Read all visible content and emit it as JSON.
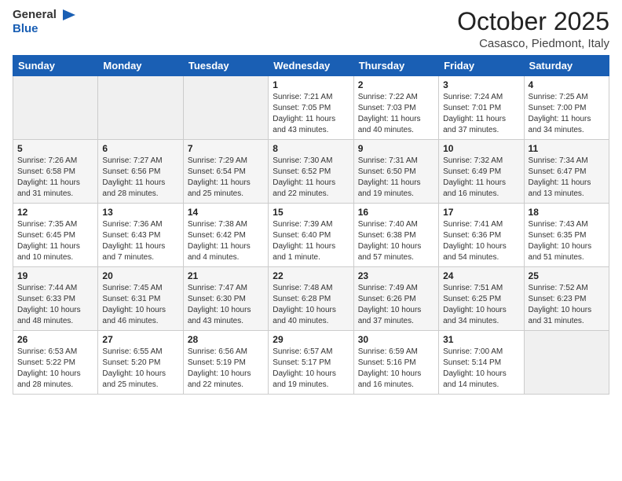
{
  "header": {
    "logo_general": "General",
    "logo_blue": "Blue",
    "month": "October 2025",
    "location": "Casasco, Piedmont, Italy"
  },
  "days_of_week": [
    "Sunday",
    "Monday",
    "Tuesday",
    "Wednesday",
    "Thursday",
    "Friday",
    "Saturday"
  ],
  "weeks": [
    [
      {
        "day": "",
        "sunrise": "",
        "sunset": "",
        "daylight": ""
      },
      {
        "day": "",
        "sunrise": "",
        "sunset": "",
        "daylight": ""
      },
      {
        "day": "",
        "sunrise": "",
        "sunset": "",
        "daylight": ""
      },
      {
        "day": "1",
        "sunrise": "Sunrise: 7:21 AM",
        "sunset": "Sunset: 7:05 PM",
        "daylight": "Daylight: 11 hours and 43 minutes."
      },
      {
        "day": "2",
        "sunrise": "Sunrise: 7:22 AM",
        "sunset": "Sunset: 7:03 PM",
        "daylight": "Daylight: 11 hours and 40 minutes."
      },
      {
        "day": "3",
        "sunrise": "Sunrise: 7:24 AM",
        "sunset": "Sunset: 7:01 PM",
        "daylight": "Daylight: 11 hours and 37 minutes."
      },
      {
        "day": "4",
        "sunrise": "Sunrise: 7:25 AM",
        "sunset": "Sunset: 7:00 PM",
        "daylight": "Daylight: 11 hours and 34 minutes."
      }
    ],
    [
      {
        "day": "5",
        "sunrise": "Sunrise: 7:26 AM",
        "sunset": "Sunset: 6:58 PM",
        "daylight": "Daylight: 11 hours and 31 minutes."
      },
      {
        "day": "6",
        "sunrise": "Sunrise: 7:27 AM",
        "sunset": "Sunset: 6:56 PM",
        "daylight": "Daylight: 11 hours and 28 minutes."
      },
      {
        "day": "7",
        "sunrise": "Sunrise: 7:29 AM",
        "sunset": "Sunset: 6:54 PM",
        "daylight": "Daylight: 11 hours and 25 minutes."
      },
      {
        "day": "8",
        "sunrise": "Sunrise: 7:30 AM",
        "sunset": "Sunset: 6:52 PM",
        "daylight": "Daylight: 11 hours and 22 minutes."
      },
      {
        "day": "9",
        "sunrise": "Sunrise: 7:31 AM",
        "sunset": "Sunset: 6:50 PM",
        "daylight": "Daylight: 11 hours and 19 minutes."
      },
      {
        "day": "10",
        "sunrise": "Sunrise: 7:32 AM",
        "sunset": "Sunset: 6:49 PM",
        "daylight": "Daylight: 11 hours and 16 minutes."
      },
      {
        "day": "11",
        "sunrise": "Sunrise: 7:34 AM",
        "sunset": "Sunset: 6:47 PM",
        "daylight": "Daylight: 11 hours and 13 minutes."
      }
    ],
    [
      {
        "day": "12",
        "sunrise": "Sunrise: 7:35 AM",
        "sunset": "Sunset: 6:45 PM",
        "daylight": "Daylight: 11 hours and 10 minutes."
      },
      {
        "day": "13",
        "sunrise": "Sunrise: 7:36 AM",
        "sunset": "Sunset: 6:43 PM",
        "daylight": "Daylight: 11 hours and 7 minutes."
      },
      {
        "day": "14",
        "sunrise": "Sunrise: 7:38 AM",
        "sunset": "Sunset: 6:42 PM",
        "daylight": "Daylight: 11 hours and 4 minutes."
      },
      {
        "day": "15",
        "sunrise": "Sunrise: 7:39 AM",
        "sunset": "Sunset: 6:40 PM",
        "daylight": "Daylight: 11 hours and 1 minute."
      },
      {
        "day": "16",
        "sunrise": "Sunrise: 7:40 AM",
        "sunset": "Sunset: 6:38 PM",
        "daylight": "Daylight: 10 hours and 57 minutes."
      },
      {
        "day": "17",
        "sunrise": "Sunrise: 7:41 AM",
        "sunset": "Sunset: 6:36 PM",
        "daylight": "Daylight: 10 hours and 54 minutes."
      },
      {
        "day": "18",
        "sunrise": "Sunrise: 7:43 AM",
        "sunset": "Sunset: 6:35 PM",
        "daylight": "Daylight: 10 hours and 51 minutes."
      }
    ],
    [
      {
        "day": "19",
        "sunrise": "Sunrise: 7:44 AM",
        "sunset": "Sunset: 6:33 PM",
        "daylight": "Daylight: 10 hours and 48 minutes."
      },
      {
        "day": "20",
        "sunrise": "Sunrise: 7:45 AM",
        "sunset": "Sunset: 6:31 PM",
        "daylight": "Daylight: 10 hours and 46 minutes."
      },
      {
        "day": "21",
        "sunrise": "Sunrise: 7:47 AM",
        "sunset": "Sunset: 6:30 PM",
        "daylight": "Daylight: 10 hours and 43 minutes."
      },
      {
        "day": "22",
        "sunrise": "Sunrise: 7:48 AM",
        "sunset": "Sunset: 6:28 PM",
        "daylight": "Daylight: 10 hours and 40 minutes."
      },
      {
        "day": "23",
        "sunrise": "Sunrise: 7:49 AM",
        "sunset": "Sunset: 6:26 PM",
        "daylight": "Daylight: 10 hours and 37 minutes."
      },
      {
        "day": "24",
        "sunrise": "Sunrise: 7:51 AM",
        "sunset": "Sunset: 6:25 PM",
        "daylight": "Daylight: 10 hours and 34 minutes."
      },
      {
        "day": "25",
        "sunrise": "Sunrise: 7:52 AM",
        "sunset": "Sunset: 6:23 PM",
        "daylight": "Daylight: 10 hours and 31 minutes."
      }
    ],
    [
      {
        "day": "26",
        "sunrise": "Sunrise: 6:53 AM",
        "sunset": "Sunset: 5:22 PM",
        "daylight": "Daylight: 10 hours and 28 minutes."
      },
      {
        "day": "27",
        "sunrise": "Sunrise: 6:55 AM",
        "sunset": "Sunset: 5:20 PM",
        "daylight": "Daylight: 10 hours and 25 minutes."
      },
      {
        "day": "28",
        "sunrise": "Sunrise: 6:56 AM",
        "sunset": "Sunset: 5:19 PM",
        "daylight": "Daylight: 10 hours and 22 minutes."
      },
      {
        "day": "29",
        "sunrise": "Sunrise: 6:57 AM",
        "sunset": "Sunset: 5:17 PM",
        "daylight": "Daylight: 10 hours and 19 minutes."
      },
      {
        "day": "30",
        "sunrise": "Sunrise: 6:59 AM",
        "sunset": "Sunset: 5:16 PM",
        "daylight": "Daylight: 10 hours and 16 minutes."
      },
      {
        "day": "31",
        "sunrise": "Sunrise: 7:00 AM",
        "sunset": "Sunset: 5:14 PM",
        "daylight": "Daylight: 10 hours and 14 minutes."
      },
      {
        "day": "",
        "sunrise": "",
        "sunset": "",
        "daylight": ""
      }
    ]
  ]
}
